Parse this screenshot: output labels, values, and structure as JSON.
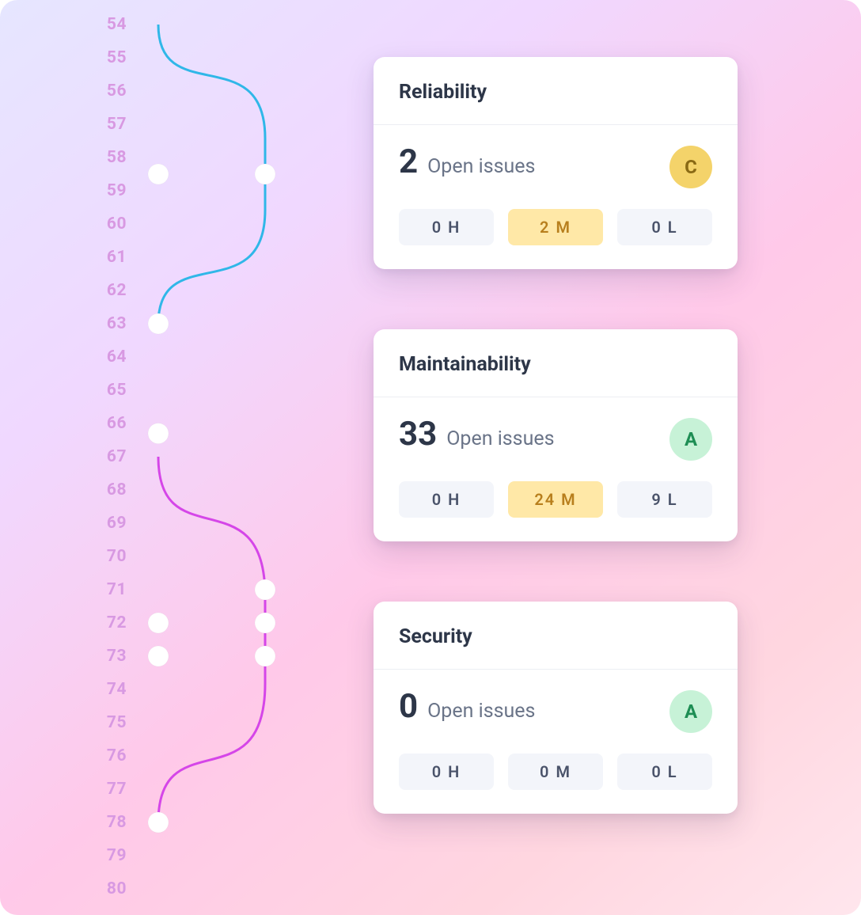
{
  "gutter": {
    "start": 54,
    "end": 80
  },
  "graph": {
    "branches": [
      {
        "id": "blue",
        "color": "#30b7e8",
        "bulge_start": 54,
        "bulge_end": 63
      },
      {
        "id": "magenta",
        "color": "#d546e8",
        "bulge_start": 67,
        "bulge_end": 78
      }
    ],
    "commits_main": [
      58.5,
      63,
      66.3,
      72,
      73,
      78
    ],
    "commits_branch": [
      {
        "branch": "blue",
        "line": 58.5
      },
      {
        "branch": "magenta",
        "line": 71
      },
      {
        "branch": "magenta",
        "line": 72
      },
      {
        "branch": "magenta",
        "line": 73
      }
    ]
  },
  "cards": [
    {
      "id": "reliability",
      "title": "Reliability",
      "count": "2",
      "count_label": "Open issues",
      "grade": "C",
      "grade_class": "grade-c",
      "severities": [
        {
          "label": "0 H",
          "active": false
        },
        {
          "label": "2 M",
          "active": true
        },
        {
          "label": "0 L",
          "active": false
        }
      ]
    },
    {
      "id": "maintainability",
      "title": "Maintainability",
      "count": "33",
      "count_label": "Open issues",
      "grade": "A",
      "grade_class": "grade-a",
      "severities": [
        {
          "label": "0 H",
          "active": false
        },
        {
          "label": "24 M",
          "active": true
        },
        {
          "label": "9 L",
          "active": false
        }
      ]
    },
    {
      "id": "security",
      "title": "Security",
      "count": "0",
      "count_label": "Open issues",
      "grade": "A",
      "grade_class": "grade-a",
      "severities": [
        {
          "label": "0 H",
          "active": false
        },
        {
          "label": "0 M",
          "active": false
        },
        {
          "label": "0 L",
          "active": false
        }
      ]
    }
  ]
}
